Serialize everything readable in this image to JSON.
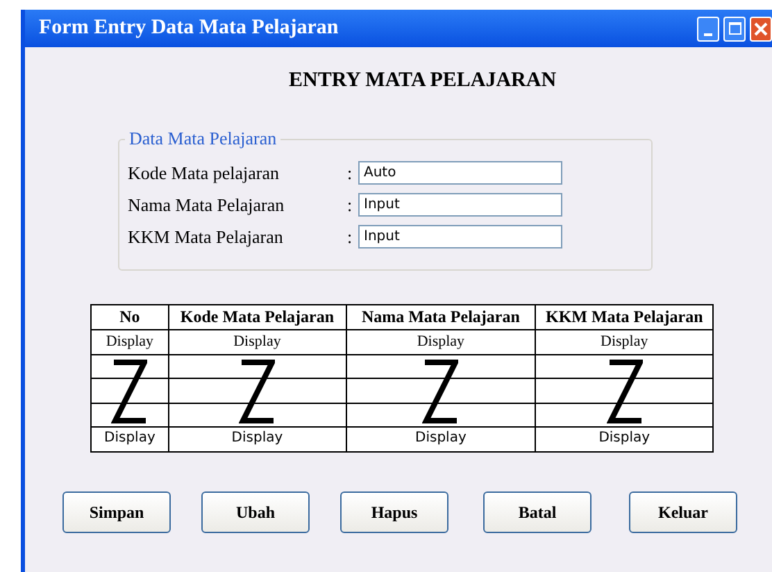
{
  "window": {
    "title": "Form Entry Data Mata Pelajaran"
  },
  "heading": "ENTRY MATA PELAJARAN",
  "group": {
    "title": "Data Mata Pelajaran",
    "fields": [
      {
        "label": "Kode Mata pelajaran",
        "separator": ":",
        "value": "Auto"
      },
      {
        "label": "Nama Mata Pelajaran",
        "separator": ":",
        "value": "Input"
      },
      {
        "label": "KKM Mata Pelajaran",
        "separator": ":",
        "value": "Input"
      }
    ]
  },
  "table": {
    "columns": [
      "No",
      "Kode Mata Pelajaran",
      "Nama Mata Pelajaran",
      "KKM Mata Pelajaran"
    ],
    "first_row": [
      "Display",
      "Display",
      "Display",
      "Display"
    ],
    "last_row": [
      "Display",
      "Display",
      "Display",
      "Display"
    ]
  },
  "buttons": [
    "Simpan",
    "Ubah",
    "Hapus",
    "Batal",
    "Keluar"
  ]
}
